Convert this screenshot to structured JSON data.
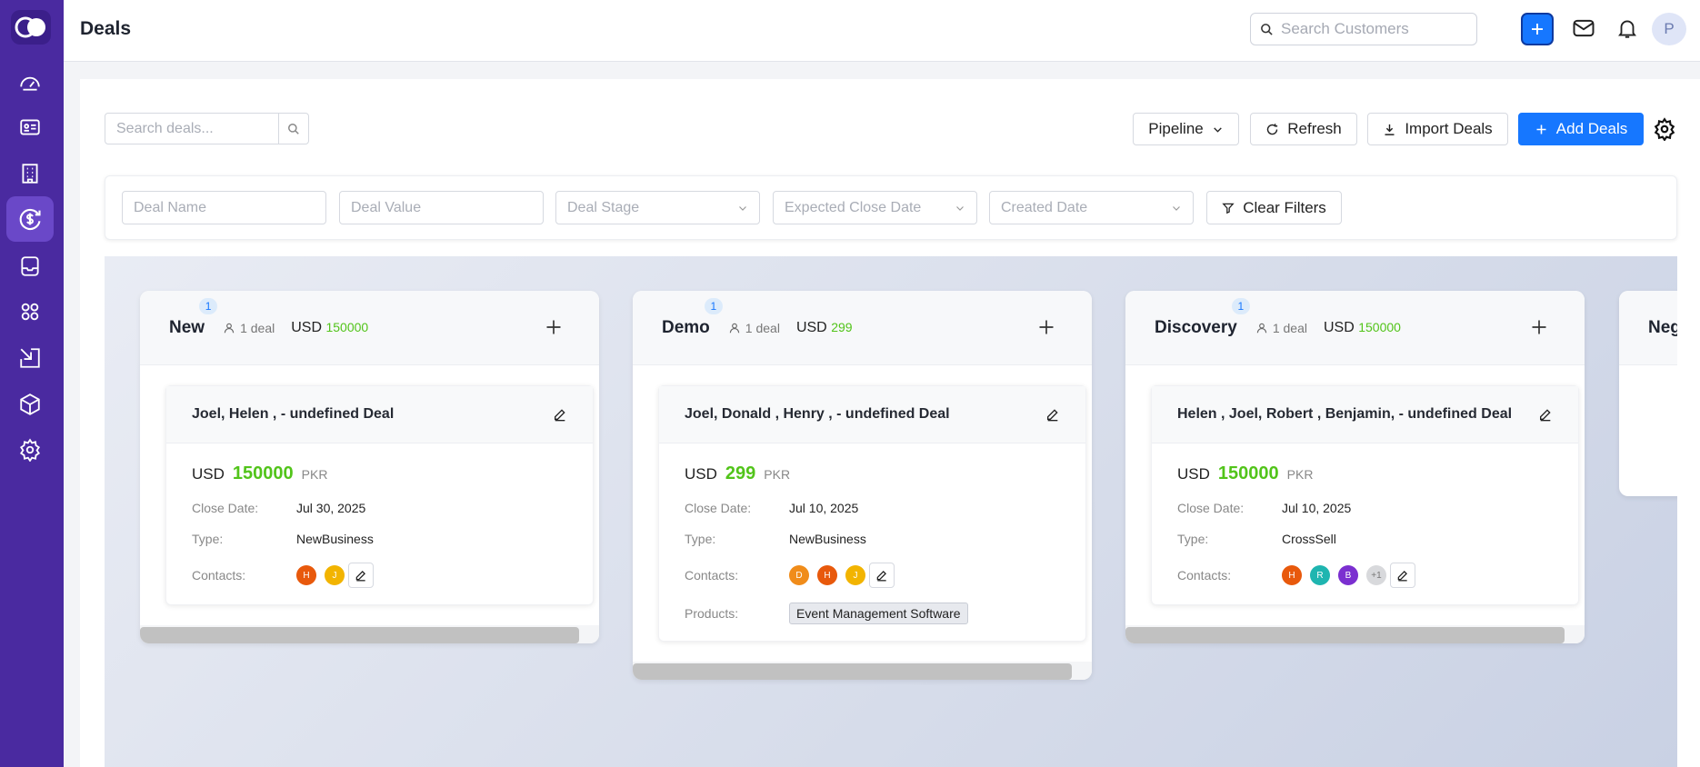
{
  "app": {
    "title": "Deals"
  },
  "header": {
    "search_placeholder": "Search Customers",
    "avatar_initial": "P"
  },
  "toolbar": {
    "deal_search_placeholder": "Search deals...",
    "pipeline_label": "Pipeline",
    "refresh_label": "Refresh",
    "import_label": "Import Deals",
    "add_label": "Add Deals"
  },
  "filters": {
    "deal_name": "Deal Name",
    "deal_value": "Deal Value",
    "deal_stage": "Deal Stage",
    "expected_close_date": "Expected Close Date",
    "created_date": "Created Date",
    "clear_label": "Clear Filters"
  },
  "colors": {
    "sidebar": "#4a2aa0",
    "primary": "#1677ff",
    "amount": "#52c41a"
  },
  "columns": [
    {
      "stage": "New",
      "count": "1",
      "deal_count": "1 deal",
      "currency": "USD",
      "total": "150000",
      "card": {
        "title": "Joel, Helen , - undefined Deal",
        "currency": "USD",
        "amount": "150000",
        "unit": "PKR",
        "close_label": "Close Date:",
        "close_date": "Jul 30, 2025",
        "type_label": "Type:",
        "type": "NewBusiness",
        "contacts_label": "Contacts:",
        "contacts": [
          {
            "i": "H",
            "c": "#e8590c"
          },
          {
            "i": "J",
            "c": "#f2b400"
          }
        ]
      }
    },
    {
      "stage": "Demo",
      "count": "1",
      "deal_count": "1 deal",
      "currency": "USD",
      "total": "299",
      "card": {
        "title": "Joel, Donald , Henry , - undefined Deal",
        "currency": "USD",
        "amount": "299",
        "unit": "PKR",
        "close_label": "Close Date:",
        "close_date": "Jul 10, 2025",
        "type_label": "Type:",
        "type": "NewBusiness",
        "contacts_label": "Contacts:",
        "contacts": [
          {
            "i": "D",
            "c": "#f08c1a"
          },
          {
            "i": "H",
            "c": "#e8590c"
          },
          {
            "i": "J",
            "c": "#f2b400"
          }
        ],
        "products_label": "Products:",
        "product": "Event Management Software"
      }
    },
    {
      "stage": "Discovery",
      "count": "1",
      "deal_count": "1 deal",
      "currency": "USD",
      "total": "150000",
      "card": {
        "title": "Helen , Joel, Robert , Benjamin, - undefined Deal",
        "currency": "USD",
        "amount": "150000",
        "unit": "PKR",
        "close_label": "Close Date:",
        "close_date": "Jul 10, 2025",
        "type_label": "Type:",
        "type": "CrossSell",
        "contacts_label": "Contacts:",
        "contacts": [
          {
            "i": "H",
            "c": "#e8590c"
          },
          {
            "i": "R",
            "c": "#1fb5b0"
          },
          {
            "i": "B",
            "c": "#7b2fd0"
          },
          {
            "i": "+1",
            "c": "#d8d9dc"
          }
        ]
      }
    },
    {
      "stage": "Neg"
    }
  ]
}
